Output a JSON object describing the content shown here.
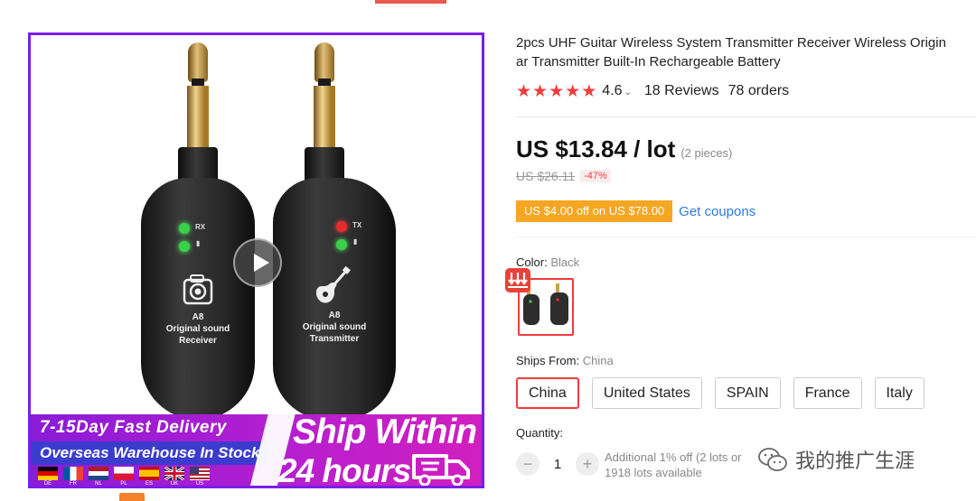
{
  "product": {
    "title_line1": "2pcs UHF Guitar Wireless System Transmitter Receiver Wireless Origin",
    "title_line2": "ar Transmitter Built-In Rechargeable Battery",
    "rating": "4.6",
    "rating_stars": 5,
    "reviews": "18 Reviews",
    "orders": "78 orders",
    "price": "US $13.84 / lot",
    "pieces": "(2 pieces)",
    "original_price": "US $26.11",
    "discount": "-47%",
    "coupon": "US $4.00 off on US $78.00",
    "get_coupons": "Get coupons"
  },
  "color": {
    "label": "Color:",
    "value": "Black"
  },
  "ships_from": {
    "label": "Ships From:",
    "value": "China",
    "options": [
      "China",
      "United States",
      "SPAIN",
      "France",
      "Italy"
    ],
    "selected": "China"
  },
  "quantity": {
    "label": "Quantity:",
    "minus": "−",
    "value": "1",
    "plus": "+",
    "info_line1": "Additional 1% off (2 lots or",
    "info_line2": "1918 lots available"
  },
  "image": {
    "receiver": {
      "led_label_1": "RX",
      "model": "A8",
      "line1": "Original sound",
      "line2": "Receiver"
    },
    "transmitter": {
      "led_label_1": "TX",
      "model": "A8",
      "line1": "Original sound",
      "line2": "Transmitter"
    },
    "banner_fast": "7-15Day Fast Delivery",
    "banner_warehouse": "Overseas Warehouse In Stock",
    "banner_ship": "Ship Within",
    "banner_hours": "24 hours",
    "flags": [
      "DE",
      "FR",
      "NL",
      "PL",
      "ES",
      "UK",
      "US"
    ]
  },
  "watermark": {
    "text": "我的推广生涯"
  },
  "colors": {
    "accent_red": "#f03c3c",
    "coupon_orange": "#f5a623",
    "link_blue": "#2d7ad6",
    "banner_purple": "#8a1bd6"
  },
  "icons": [
    "play-icon",
    "camera-icon",
    "guitar-icon",
    "truck-icon",
    "star-icon",
    "chevron-down-icon",
    "wechat-icon",
    "badge-icon"
  ]
}
